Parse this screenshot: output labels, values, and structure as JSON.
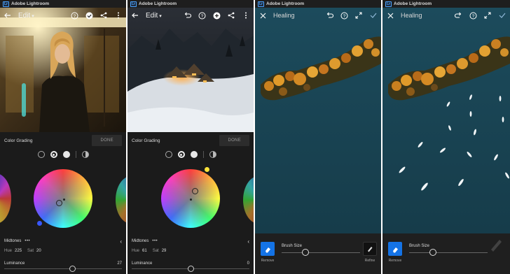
{
  "app_title": "Adobe Lightroom",
  "lr_badge": "Lr",
  "panels": [
    {
      "toolbar_title": "Edit",
      "section_title": "Color Grading",
      "done_label": "DONE",
      "zone_label": "Midtones",
      "more": "•••",
      "hue_label": "Hue",
      "hue_value": "225",
      "sat_label": "Sat",
      "sat_value": "20",
      "luminance_label": "Luminance",
      "luminance_value": "27",
      "luminance_level": 0.58
    },
    {
      "toolbar_title": "Edit",
      "section_title": "Color Grading",
      "done_label": "DONE",
      "zone_label": "Midtones",
      "more": "•••",
      "hue_label": "Hue",
      "hue_value": "61",
      "sat_label": "Sat",
      "sat_value": "29",
      "luminance_label": "Luminance",
      "luminance_value": "0",
      "luminance_level": 0.5
    },
    {
      "toolbar_title": "Healing",
      "remove_label": "Remove",
      "brush_size_label": "Brush Size",
      "refine_label": "Refine",
      "brush_level": 0.3
    },
    {
      "toolbar_title": "Healing",
      "remove_label": "Remove",
      "brush_size_label": "Brush Size",
      "brush_level": 0.3
    }
  ],
  "colors": {
    "accent_blue": "#1473e6",
    "panel_bg": "#1b1b1b",
    "water": "#1d4a5c"
  },
  "icons": [
    "back-arrow-icon",
    "help-icon",
    "checkmark-circle-icon",
    "share-icon",
    "more-vertical-icon",
    "undo-icon",
    "add-icon",
    "close-icon",
    "redo-icon",
    "expand-icon",
    "check-icon",
    "eraser-icon",
    "brush-refine-icon"
  ]
}
